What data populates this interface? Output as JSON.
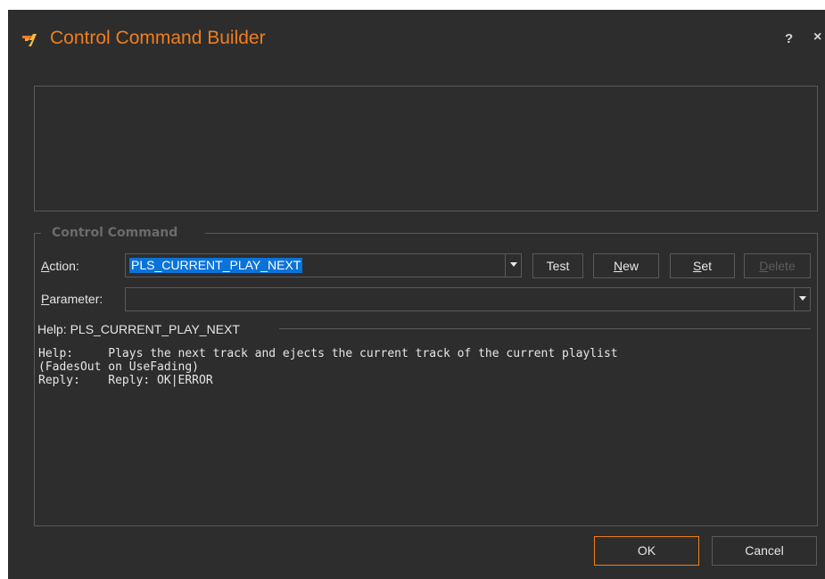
{
  "window": {
    "title": "Control Command Builder",
    "help_button": "?",
    "close_button": "×",
    "title_color": "#f07e1b",
    "accent_color": "#f07e1b",
    "selection_color": "#0a73d9"
  },
  "control_command": {
    "group_label": "Control Command",
    "action": {
      "label_prefix": "A",
      "label_rest": "ction:",
      "value": "PLS_CURRENT_PLAY_NEXT"
    },
    "parameter": {
      "label_prefix": "P",
      "label_rest": "arameter:",
      "value": ""
    },
    "buttons": {
      "test": "Test",
      "new_prefix": "N",
      "new_rest": "ew",
      "set_prefix": "S",
      "set_rest": "et",
      "delete_prefix": "D",
      "delete_rest": "elete"
    }
  },
  "help": {
    "heading": "Help: PLS_CURRENT_PLAY_NEXT",
    "text": "Help:     Plays the next track and ejects the current track of the current playlist\n(FadesOut on UseFading)\nReply:    Reply: OK|ERROR"
  },
  "footer": {
    "ok": "OK",
    "cancel": "Cancel"
  },
  "icons": {
    "app": "app-logo-icon",
    "dropdown": "chevron-down-icon"
  }
}
